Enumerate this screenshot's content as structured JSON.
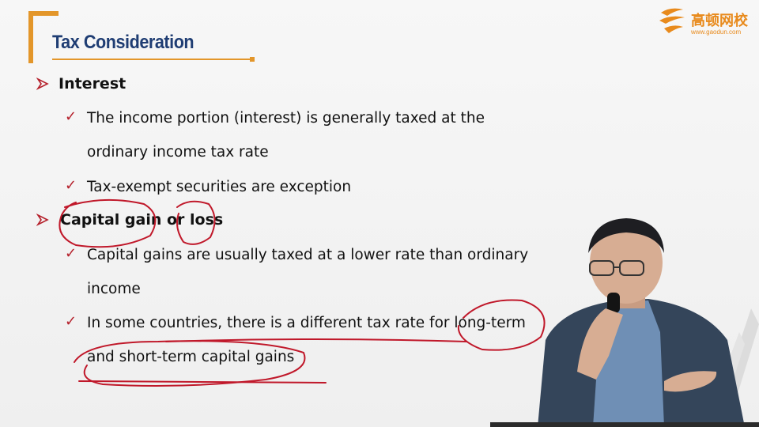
{
  "slide": {
    "title": "Tax Consideration",
    "logo": {
      "name_cn": "高顿网校",
      "url": "www.gaodun.com"
    },
    "bullets": [
      {
        "label": "Interest",
        "subs": [
          {
            "line1": "The income portion (interest) is generally taxed at the",
            "line2": "ordinary income tax rate"
          },
          {
            "line1": "Tax-exempt securities are exception",
            "line2": ""
          }
        ]
      },
      {
        "label": "Capital gain or loss",
        "subs": [
          {
            "line1": "Capital gains are usually taxed at a lower rate than ordinary",
            "line2": "income"
          },
          {
            "line1": "In some countries, there is a different tax rate for long-term",
            "line2": "and short-term capital gains"
          }
        ]
      }
    ]
  },
  "colors": {
    "accent": "#e3962a",
    "title": "#1f3d73",
    "check": "#b5202b",
    "annotation": "#c0182a"
  },
  "icons": [
    "arrow-bullet-icon",
    "checkmark-icon",
    "gaodun-logo-icon"
  ]
}
